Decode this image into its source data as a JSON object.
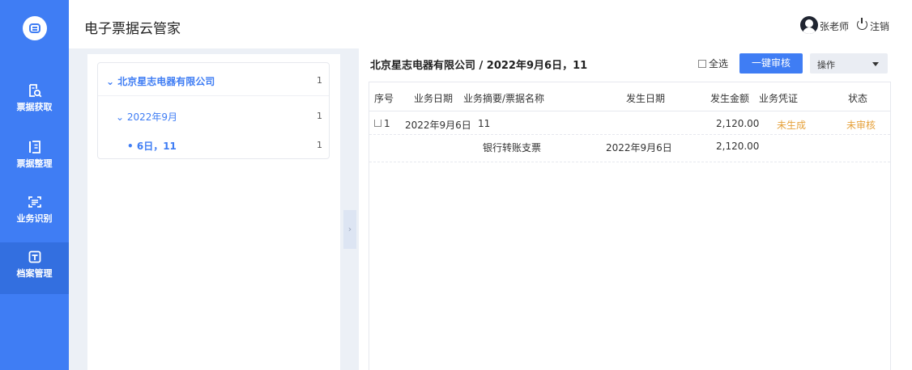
{
  "app": {
    "title": "电子票据云管家"
  },
  "user": {
    "name": "张老师",
    "logout": "注销"
  },
  "sidebar": {
    "items": [
      {
        "label": "票据获取",
        "icon": "receipt-search-icon"
      },
      {
        "label": "票据整理",
        "icon": "list-icon"
      },
      {
        "label": "业务识别",
        "icon": "scan-icon"
      },
      {
        "label": "档案管理",
        "icon": "archive-icon",
        "active": true
      }
    ]
  },
  "tree": {
    "company": {
      "label": "北京星志电器有限公司",
      "count": "1"
    },
    "month": {
      "label": "2022年9月",
      "count": "1"
    },
    "day": {
      "label": "6日，11",
      "count": "1"
    }
  },
  "main": {
    "title": "北京星志电器有限公司 / 2022年9月6日，11",
    "select_all": "全选",
    "review_button": "一键审核",
    "operation_select": "操作"
  },
  "table": {
    "headers": [
      "序号",
      "业务日期",
      "业务摘要/票据名称",
      "发生日期",
      "发生金额",
      "业务凭证",
      "状态"
    ],
    "rows": [
      {
        "index": "1",
        "biz_date": "2022年9月6日",
        "summary": "11",
        "occur_date": "",
        "amount": "2,120.00",
        "voucher": "未生成",
        "status": "未审核"
      },
      {
        "index": "",
        "biz_date": "",
        "summary": "银行转账支票",
        "occur_date": "2022年9月6日",
        "amount": "2,120.00",
        "voucher": "",
        "status": ""
      }
    ]
  },
  "colors": {
    "primary": "#3f7df4",
    "warning": "#e6a23c",
    "background": "#ecf0f6"
  }
}
